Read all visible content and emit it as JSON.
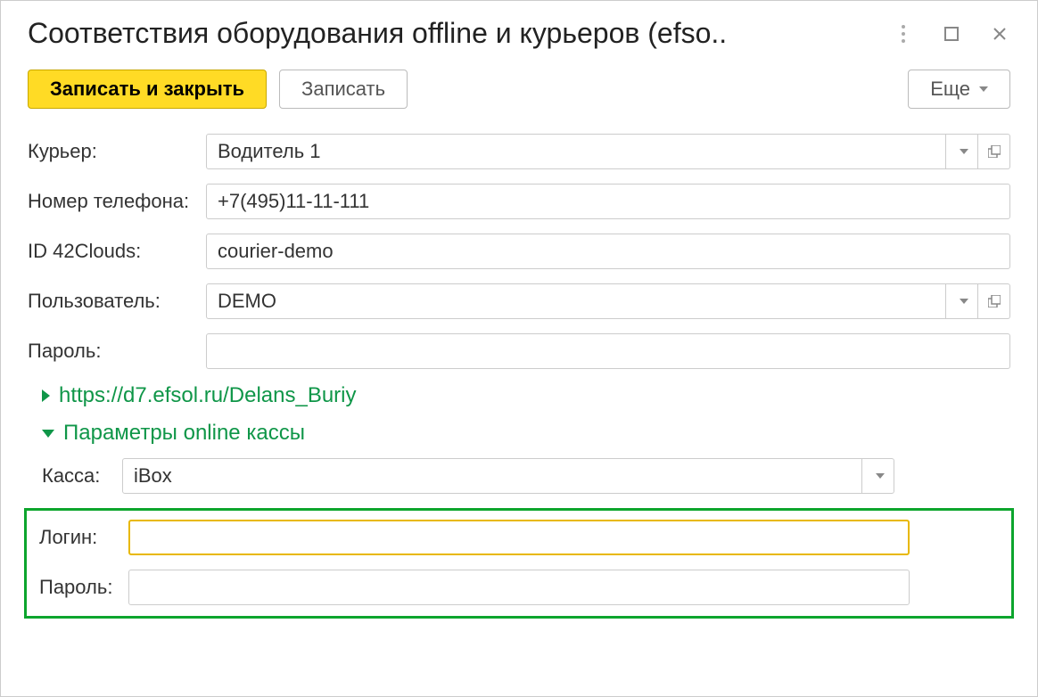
{
  "title": "Соответствия оборудования offline и курьеров (efso..",
  "toolbar": {
    "save_close_label": "Записать и закрыть",
    "save_label": "Записать",
    "more_label": "Еще"
  },
  "fields": {
    "courier_label": "Курьер:",
    "courier_value": "Водитель 1",
    "phone_label": "Номер телефона:",
    "phone_value": "+7(495)11-11-111",
    "id42_label": "ID 42Clouds:",
    "id42_value": "courier-demo",
    "user_label": "Пользователь:",
    "user_value": "DEMO",
    "password_label": "Пароль:",
    "password_value": ""
  },
  "sections": {
    "link_text": "https://d7.efsol.ru/Delans_Buriy",
    "online_kassa_title": "Параметры online кассы"
  },
  "kassa": {
    "kassa_label": "Касса:",
    "kassa_value": "iBox",
    "login_label": "Логин:",
    "login_value": "",
    "password_label": "Пароль:",
    "password_value": ""
  }
}
